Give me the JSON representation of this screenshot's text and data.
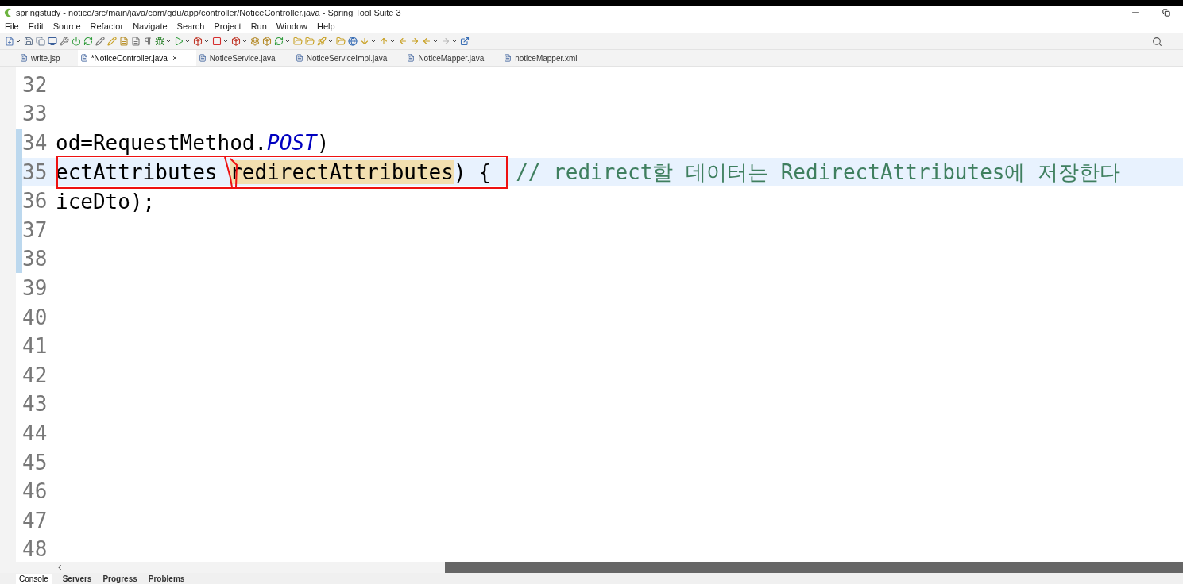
{
  "window": {
    "title": "springstudy - notice/src/main/java/com/gdu/app/controller/NoticeController.java - Spring Tool Suite 3"
  },
  "menu": [
    "File",
    "Edit",
    "Source",
    "Refactor",
    "Navigate",
    "Search",
    "Project",
    "Run",
    "Window",
    "Help"
  ],
  "editor_tabs": [
    {
      "label": "write.jsp",
      "selected": false
    },
    {
      "label": "*NoticeController.java",
      "selected": true
    },
    {
      "label": "NoticeService.java",
      "selected": false
    },
    {
      "label": "NoticeServiceImpl.java",
      "selected": false
    },
    {
      "label": "NoticeMapper.java",
      "selected": false
    },
    {
      "label": "noticeMapper.xml",
      "selected": false
    }
  ],
  "code_lines": [
    {
      "number": "32",
      "selected": false
    },
    {
      "number": "33",
      "selected": false
    },
    {
      "number": "34",
      "selected": false,
      "segments": [
        {
          "kind": "plain",
          "text": "od=RequestMethod."
        },
        {
          "kind": "constant",
          "text": "POST"
        },
        {
          "kind": "plain",
          "text": ")"
        }
      ]
    },
    {
      "number": "35",
      "selected": true,
      "segments": [
        {
          "kind": "plain",
          "text": "ectAttributes "
        },
        {
          "kind": "occurrence",
          "text": "redirectAttributes"
        },
        {
          "kind": "plain",
          "text": ") {  "
        },
        {
          "kind": "comment",
          "text": "// redirect할 데이터는 RedirectAttributes에 저장한다"
        }
      ]
    },
    {
      "number": "36",
      "selected": false,
      "segments": [
        {
          "kind": "plain",
          "text": "iceDto);"
        }
      ]
    },
    {
      "number": "37",
      "selected": false
    },
    {
      "number": "38",
      "selected": false
    },
    {
      "number": "39",
      "selected": false
    },
    {
      "number": "40",
      "selected": false
    },
    {
      "number": "41",
      "selected": false
    },
    {
      "number": "42",
      "selected": false
    },
    {
      "number": "43",
      "selected": false
    },
    {
      "number": "44",
      "selected": false
    },
    {
      "number": "45",
      "selected": false
    },
    {
      "number": "46",
      "selected": false
    },
    {
      "number": "47",
      "selected": false
    },
    {
      "number": "48",
      "selected": false
    }
  ],
  "bottom_tabs": [
    {
      "label": "Console",
      "selected": true
    },
    {
      "label": "Servers",
      "selected": false
    },
    {
      "label": "Progress",
      "selected": false
    },
    {
      "label": "Problems",
      "selected": false
    }
  ]
}
